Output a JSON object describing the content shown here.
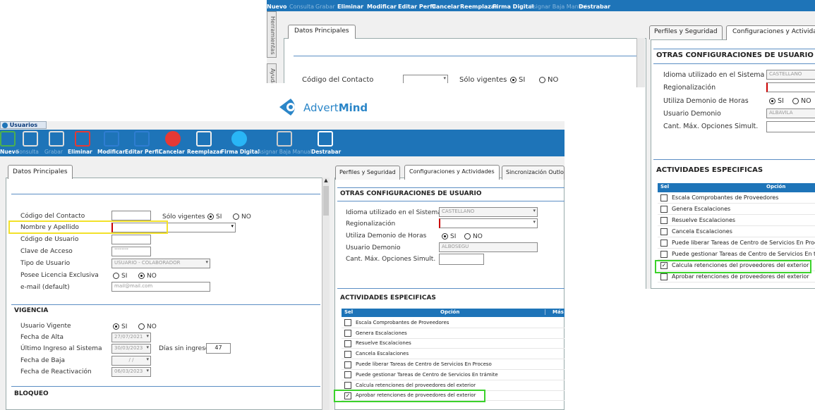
{
  "logo": {
    "text_plain": "Advert",
    "text_bold": "Mind"
  },
  "toolbar_back": {
    "items": [
      {
        "label": "Nuevo",
        "enabled": true
      },
      {
        "label": "Consulta",
        "enabled": false
      },
      {
        "label": "Grabar",
        "enabled": false
      },
      {
        "label": "Eliminar",
        "enabled": true
      },
      {
        "label": "Modificar",
        "enabled": true
      },
      {
        "label": "Editar Perfil",
        "enabled": true
      },
      {
        "label": "Cancelar",
        "enabled": true
      },
      {
        "label": "Reemplazar",
        "enabled": true
      },
      {
        "label": "Firma Digital",
        "enabled": true
      },
      {
        "label": "Asignar Baja Manual",
        "enabled": false
      },
      {
        "label": "Destrabar",
        "enabled": true
      }
    ]
  },
  "side_tabs": [
    "Herramientas",
    "Ayuda"
  ],
  "window": {
    "title": "Usuarios"
  },
  "toolbar": {
    "items": [
      {
        "label": "Nuevo",
        "enabled": true
      },
      {
        "label": "Consulta",
        "enabled": false
      },
      {
        "label": "Grabar",
        "enabled": false
      },
      {
        "label": "Eliminar",
        "enabled": true
      },
      {
        "label": "Modificar",
        "enabled": true
      },
      {
        "label": "Editar Perfil",
        "enabled": true
      },
      {
        "label": "Cancelar",
        "enabled": true
      },
      {
        "label": "Reemplazar",
        "enabled": true
      },
      {
        "label": "Firma Digital",
        "enabled": true
      },
      {
        "label": "Asignar Baja Manual",
        "enabled": false
      },
      {
        "label": "Destrabar",
        "enabled": true
      }
    ]
  },
  "left": {
    "tab": "Datos Principales",
    "codigo_contacto": "Código del Contacto",
    "solo_vigentes": "Sólo vigentes",
    "si": "SI",
    "no": "NO",
    "nombre": "Nombre y Apellido",
    "codigo_usuario": "Código de Usuario",
    "clave": "Clave de Acceso",
    "clave_val": "********",
    "tipo": "Tipo de Usuario",
    "tipo_val": "USUARIO - COLABORADOR",
    "licencia": "Posee Licencia Exclusiva",
    "email": "e-mail (default)",
    "email_val": "mail@mail.com",
    "vigencia": "VIGENCIA",
    "usuario_vigente": "Usuario Vigente",
    "fecha_alta": "Fecha de Alta",
    "fecha_alta_val": "27/07/2021",
    "ultimo_ingreso": "Último Ingreso al Sistema",
    "ultimo_ingreso_val": "30/03/2023",
    "dias_sin": "Días sin ingreso",
    "dias_sin_val": "47",
    "fecha_baja": "Fecha de Baja",
    "fecha_baja_val": "/ /",
    "fecha_react": "Fecha de Reactivación",
    "fecha_react_val": "06/03/2023",
    "bloqueo": "BLOQUEO"
  },
  "right": {
    "tabs": [
      "Perfiles y Seguridad",
      "Configuraciones y Actividades",
      "Sincronización Outlook"
    ],
    "otras": "OTRAS CONFIGURACIONES DE USUARIO",
    "idioma": "Idioma utilizado en el Sistema",
    "idioma_val": "CASTELLANO",
    "regional": "Regionalización",
    "demonio": "Utiliza Demonio de Horas",
    "usuario_demonio": "Usuario Demonio",
    "usuario_demonio_val": "ALBOSEGU",
    "cant_max": "Cant. Máx. Opciones Simult.",
    "actividades": "ACTIVIDADES ESPECIFICAS",
    "col_sel": "Sel",
    "col_opcion": "Opción",
    "col_mas": "Más",
    "rows": [
      {
        "label": "Escala Comprobantes de Proveedores",
        "checked": false
      },
      {
        "label": "Genera Escalaciones",
        "checked": false
      },
      {
        "label": "Resuelve Escalaciones",
        "checked": false
      },
      {
        "label": "Cancela Escalaciones",
        "checked": false
      },
      {
        "label": "Puede liberar Tareas de Centro de Servicios En Proceso",
        "checked": false
      },
      {
        "label": "Puede gestionar Tareas de Centro de Servicios En trámite",
        "checked": false
      },
      {
        "label": "Calcula retenciones del proveedores del exterior",
        "checked": false
      },
      {
        "label": "Aprobar retenciones de proveedores del exterior",
        "checked": true
      }
    ]
  },
  "back_right": {
    "tabs": [
      "Perfiles y Seguridad",
      "Configuraciones y Actividades"
    ],
    "idioma_val": "CASTELLANO",
    "usuario_demonio_val": "ALBAVILA",
    "rows": [
      {
        "label": "Escala Comprobantes de Proveedores",
        "checked": false
      },
      {
        "label": "Genera Escalaciones",
        "checked": false
      },
      {
        "label": "Resuelve Escalaciones",
        "checked": false
      },
      {
        "label": "Cancela Escalaciones",
        "checked": false
      },
      {
        "label": "Puede liberar Tareas de Centro de Servicios En Proceso",
        "checked": false
      },
      {
        "label": "Puede gestionar Tareas de Centro de Servicios En trámite",
        "checked": false
      },
      {
        "label": "Calcula retenciones del proveedores del exterior",
        "checked": true
      },
      {
        "label": "Aprobar retenciones de proveedores del exterior",
        "checked": false
      }
    ]
  },
  "colors": {
    "accent": "#1e74b8",
    "highlight_green": "#3bd22b",
    "highlight_yellow": "#f2e12a"
  }
}
